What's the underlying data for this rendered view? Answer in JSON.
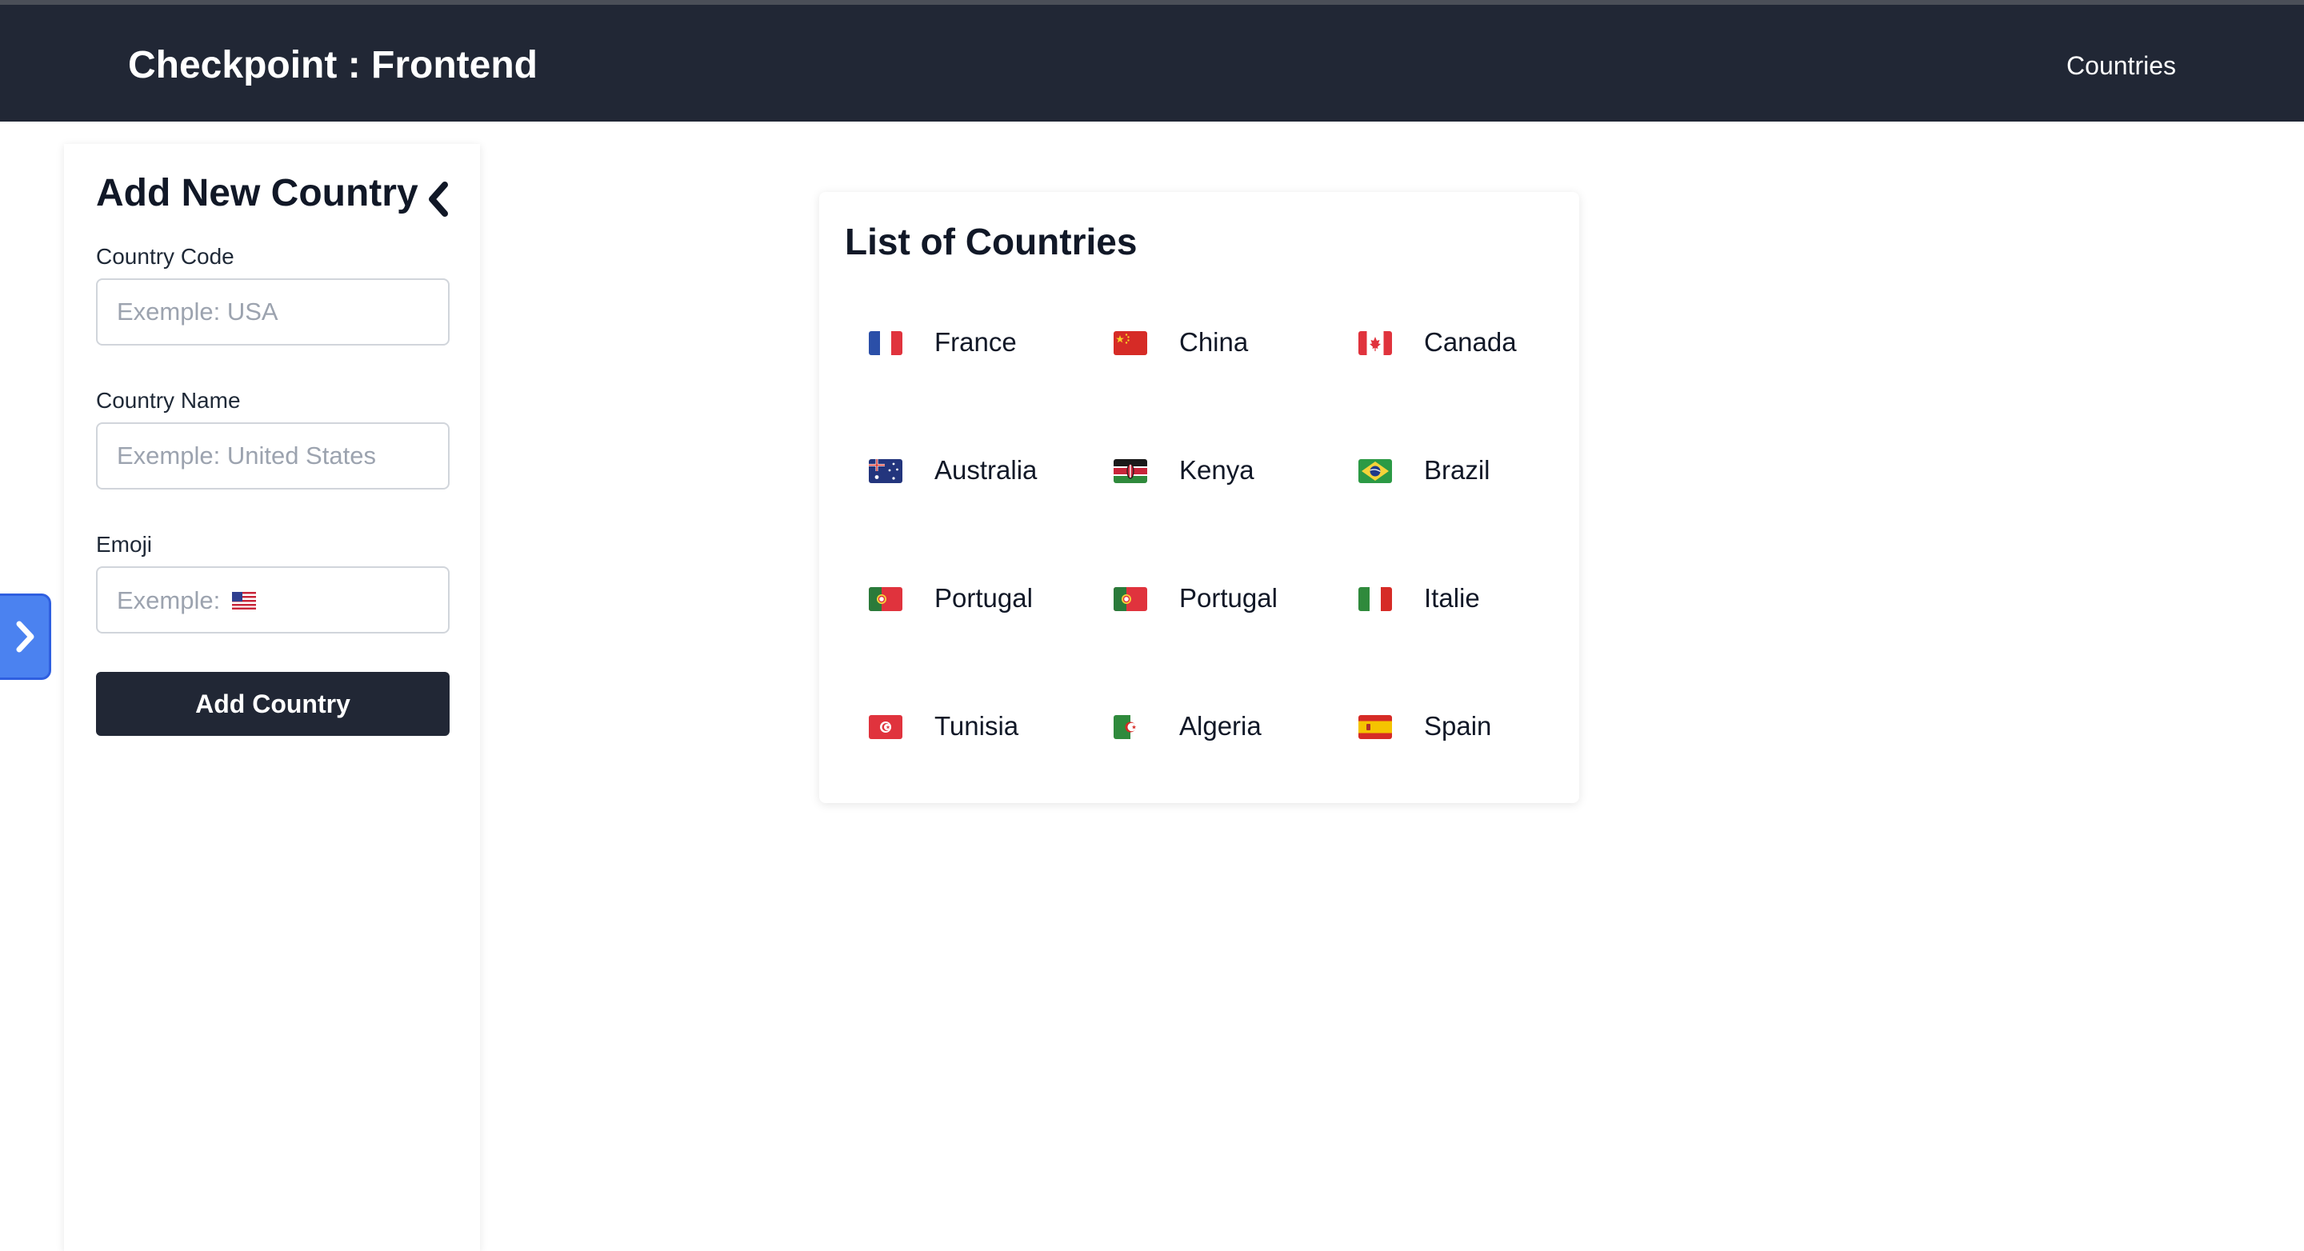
{
  "header": {
    "app_title": "Checkpoint : Frontend",
    "nav_link": "Countries",
    "background_color": "#212735"
  },
  "sidebar": {
    "title": "Add New Country",
    "collapse_icon": "chevron-left-icon",
    "fields": [
      {
        "label": "Country Code",
        "placeholder": "Exemple: USA",
        "value": ""
      },
      {
        "label": "Country Name",
        "placeholder": "Exemple: United States",
        "value": ""
      },
      {
        "label": "Emoji",
        "placeholder": "Exemple: 🇺🇸",
        "value": ""
      }
    ],
    "submit_label": "Add Country",
    "submit_color": "#212735"
  },
  "side_toggle": {
    "icon": "chevron-right-icon",
    "color": "#4b82f0"
  },
  "countries_card": {
    "title": "List of Countries",
    "items": [
      {
        "flag": "🇫🇷",
        "name": "France",
        "icon": "flag-france-icon"
      },
      {
        "flag": "🇨🇳",
        "name": "China",
        "icon": "flag-china-icon"
      },
      {
        "flag": "🇨🇦",
        "name": "Canada",
        "icon": "flag-canada-icon"
      },
      {
        "flag": "🇦🇺",
        "name": "Australia",
        "icon": "flag-australia-icon"
      },
      {
        "flag": "🇰🇪",
        "name": "Kenya",
        "icon": "flag-kenya-icon"
      },
      {
        "flag": "🇧🇷",
        "name": "Brazil",
        "icon": "flag-brazil-icon"
      },
      {
        "flag": "🇵🇹",
        "name": "Portugal",
        "icon": "flag-portugal-icon"
      },
      {
        "flag": "🇵🇹",
        "name": "Portugal",
        "icon": "flag-portugal-icon"
      },
      {
        "flag": "🇮🇹",
        "name": "Italie",
        "icon": "flag-italy-icon"
      },
      {
        "flag": "🇹🇳",
        "name": "Tunisia",
        "icon": "flag-tunisia-icon"
      },
      {
        "flag": "🇩🇿",
        "name": "Algeria",
        "icon": "flag-algeria-icon"
      },
      {
        "flag": "🇪🇸",
        "name": "Spain",
        "icon": "flag-spain-icon"
      }
    ]
  }
}
